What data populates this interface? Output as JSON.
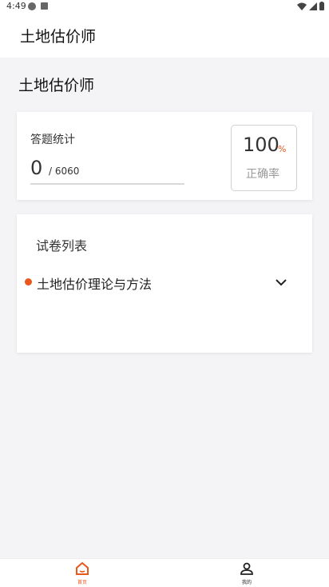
{
  "status_bar": {
    "time": "4:49",
    "icons": [
      "notification-dot-icon",
      "notification-a-icon",
      "wifi-icon",
      "signal-icon",
      "battery-icon"
    ]
  },
  "app_bar": {
    "title": "土地估价师"
  },
  "page": {
    "title": "土地估价师"
  },
  "stats": {
    "label": "答题统计",
    "answered": "0",
    "total": "/ 6060",
    "rate_value": "100",
    "rate_unit": "%",
    "rate_label": "正确率"
  },
  "exam_list": {
    "title": "试卷列表",
    "items": [
      {
        "label": "土地估价理论与方法",
        "icon": "chevron-down-icon"
      }
    ]
  },
  "bottom_nav": {
    "items": [
      {
        "label": "首页",
        "icon": "home-icon",
        "active": true
      },
      {
        "label": "我的",
        "icon": "person-icon",
        "active": false
      }
    ]
  },
  "colors": {
    "accent": "#e8581c",
    "background": "#f4f4f6"
  }
}
